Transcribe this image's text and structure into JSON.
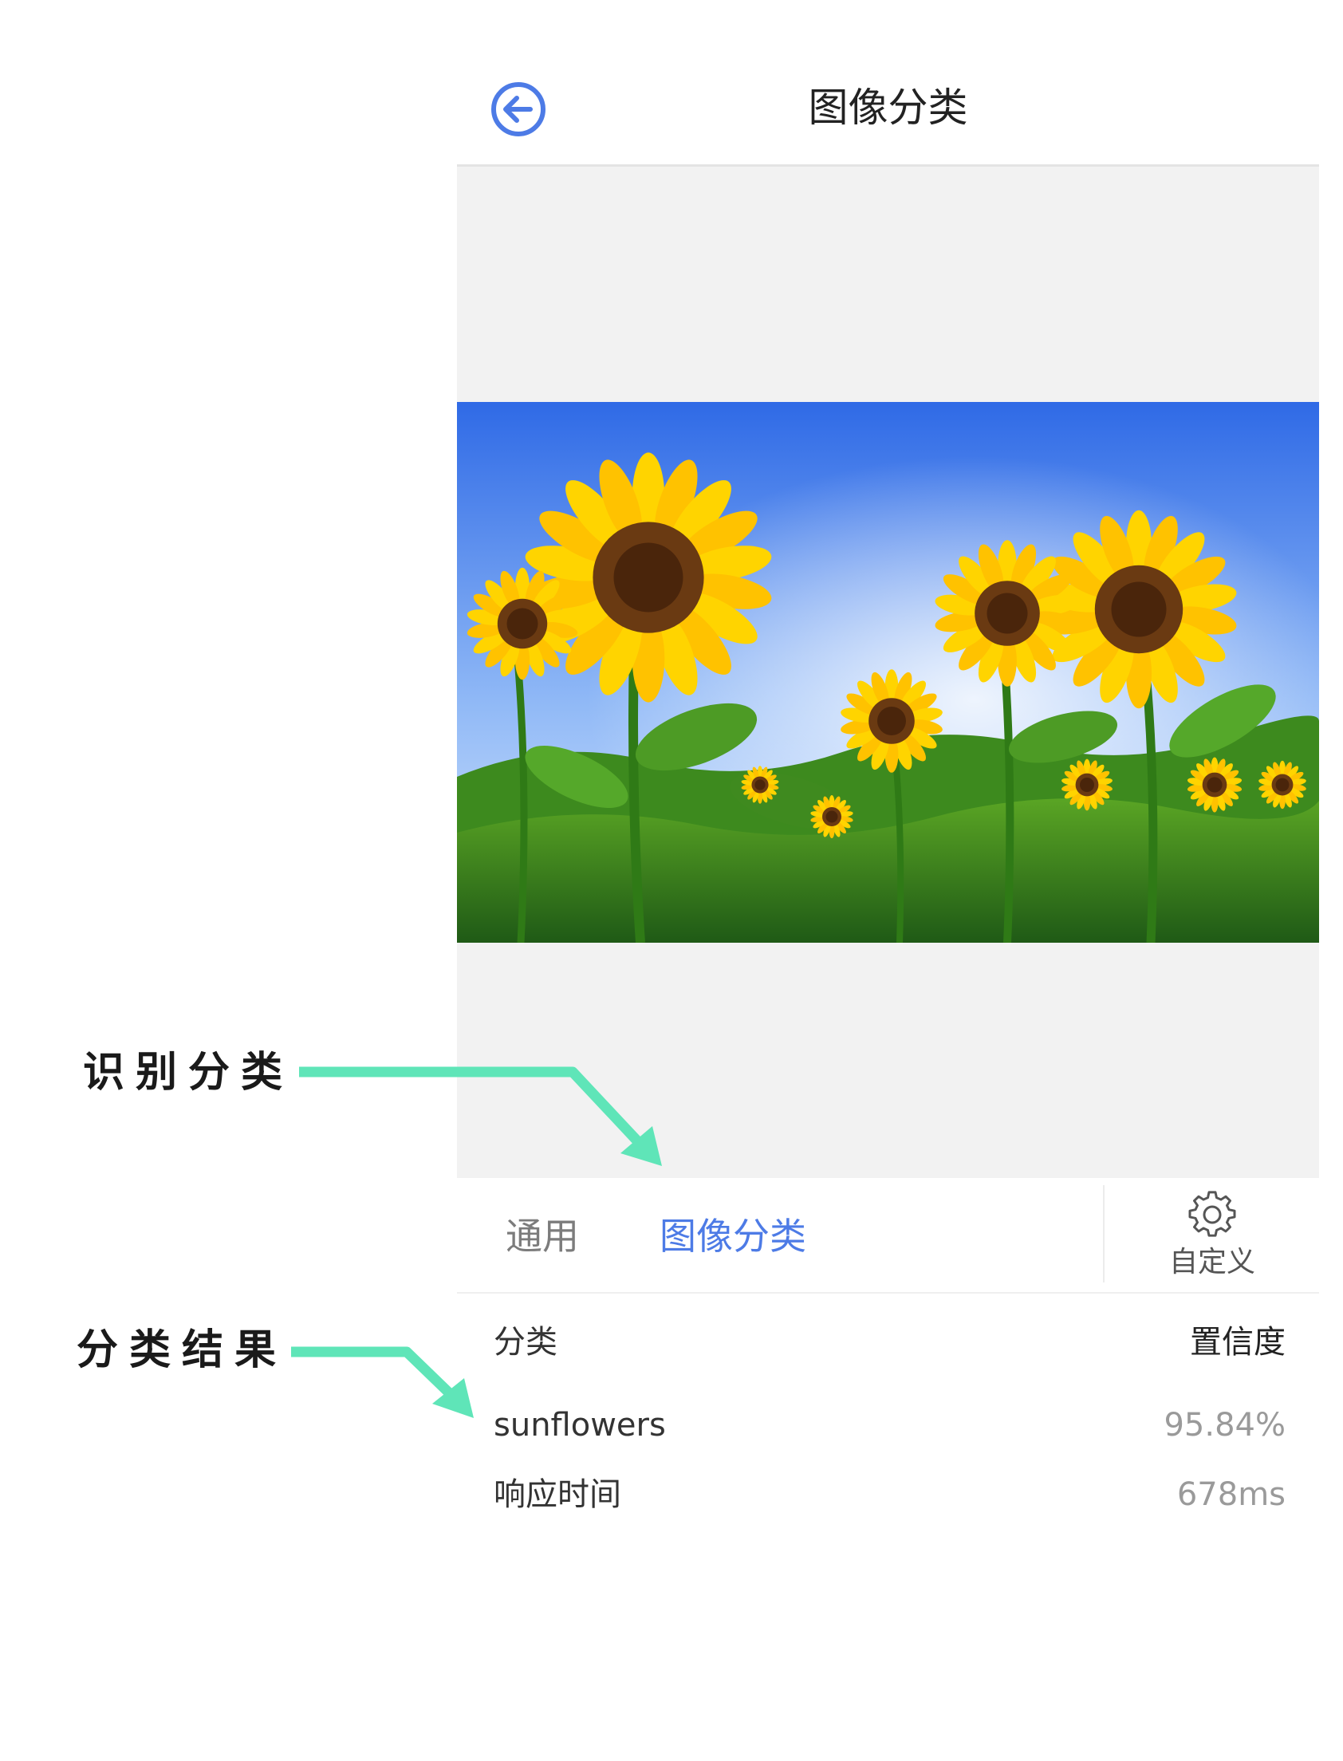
{
  "header": {
    "title": "图像分类",
    "back_icon": "back-arrow-icon",
    "accent_color": "#4d7be6"
  },
  "preview": {
    "image_subject": "sunflowers",
    "background_color": "#f2f2f2"
  },
  "tabs": {
    "general_label": "通用",
    "image_classify_label": "图像分类",
    "active_tab": "图像分类",
    "custom_icon": "gear-icon",
    "custom_label": "自定义"
  },
  "results": {
    "col_class": "分类",
    "col_confidence": "置信度",
    "items": [
      {
        "label": "sunflowers",
        "score": "95.84%"
      }
    ],
    "response_time_label": "响应时间",
    "response_time_value": "678ms"
  },
  "annotations": {
    "recognize_classify": "识别分类",
    "classify_result": "分类结果",
    "arrow_color": "#5fe5b8"
  }
}
